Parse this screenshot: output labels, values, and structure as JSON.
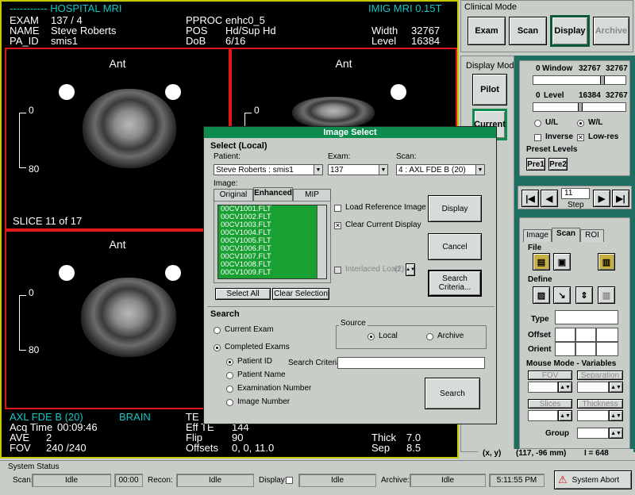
{
  "viewer": {
    "hospital": "----------- HOSPITAL MRI",
    "system": "IMIG MRI 0.15T",
    "exam_label": "EXAM",
    "exam_value": "137  / 4",
    "name_label": "NAME",
    "name_value": "Steve Roberts",
    "paid_label": "PA_ID",
    "paid_value": "smis1",
    "pproc_label": "PPROC",
    "pproc_value": "enhc0_5",
    "pos_label": "POS",
    "pos_value": "Hd/Sup  Hd",
    "dob_label": "DoB",
    "dob_value": "6/16",
    "width_label": "Width",
    "width_value": "32767",
    "level_label": "Level",
    "level_value": "16384",
    "ant": "Ant",
    "ruler_top": "0",
    "ruler_bottom": "80",
    "slice": "SLICE 11 of 17",
    "series": "AXL FDE B (20)",
    "region": "BRAIN",
    "acq_label": "Acq Time",
    "acq_value": "00:09:46",
    "ave_label": "AVE",
    "ave_value": "2",
    "fov_label": "FOV",
    "fov_value": "240  /240",
    "te_label": "TE",
    "effte_label": "Eff TE",
    "effte_value": "144",
    "flip_label": "Flip",
    "flip_value": "90",
    "offsets_label": "Offsets",
    "offsets_value": "0, 0, 11.0",
    "thick_label": "Thick",
    "thick_value": "7.0",
    "sep_label": "Sep",
    "sep_value": "8.5"
  },
  "clinical": {
    "title": "Clinical Mode",
    "buttons": [
      "Exam",
      "Scan",
      "Display",
      "Archive"
    ],
    "display_mode_title": "Display Mode",
    "pilot": "Pilot",
    "current": "Current"
  },
  "window_level": {
    "window_min": "0",
    "window_label": "Window",
    "window_value": "32767",
    "window_max": "32767",
    "level_min": "0",
    "level_label": "Level",
    "level_value": "16384",
    "level_max": "32767",
    "ul": "U/L",
    "wl": "W/L",
    "inverse": "Inverse",
    "lowres": "Low-res",
    "preset_title": "Preset Levels",
    "pre1": "Pre1",
    "pre2": "Pre2"
  },
  "stepper": {
    "value": "11",
    "step": "Step"
  },
  "tabs_panel": {
    "tabs": [
      "Image",
      "Scan",
      "ROI"
    ],
    "file": "File",
    "define": "Define",
    "type": "Type",
    "offset": "Offset",
    "orient": "Orient",
    "mouse_mode": "Mouse Mode - Variables",
    "fov": "FOV",
    "separation": "Separation",
    "slices": "Slices",
    "thickness": "Thickness",
    "group": "Group"
  },
  "coords": {
    "xy": "(x, y)",
    "xy_value": "(117, -96 mm)",
    "i": "I =  648"
  },
  "dialog": {
    "title": "Image Select",
    "select_local": "Select (Local)",
    "patient_label": "Patient:",
    "patient_value": "Steve Roberts : smis1",
    "exam_label": "Exam:",
    "exam_value": "137",
    "scan_label": "Scan:",
    "scan_value": "4 : AXL FDE B (20)",
    "image_label": "Image:",
    "image_tabs": [
      "Original",
      "Enhanced",
      "MIP"
    ],
    "files": [
      "00CV1001.FLT",
      "00CV1002.FLT",
      "00CV1003.FLT",
      "00CV1004.FLT",
      "00CV1005.FLT",
      "00CV1006.FLT",
      "00CV1007.FLT",
      "00CV1008.FLT",
      "00CV1009.FLT"
    ],
    "load_reference": "Load Reference Image",
    "clear_current": "Clear Current Display",
    "interlaced": "Interlaced  Load",
    "interlaced_value": "(2)",
    "display_btn": "Display",
    "cancel_btn": "Cancel",
    "search_criteria_btn": "Search Criteria...",
    "select_all": "Select All",
    "clear_selection": "Clear Selection",
    "search_title": "Search",
    "current_exam": "Current Exam",
    "completed_exams": "Completed Exams",
    "source_title": "Source",
    "local": "Local",
    "archive": "Archive",
    "patient_id": "Patient ID",
    "patient_name": "Patient Name",
    "exam_number": "Examination Number",
    "image_number": "Image Number",
    "search_criteria_label": "Search Criteria:",
    "search_btn": "Search"
  },
  "status": {
    "title": "System Status",
    "scan_label": "Scan:",
    "scan_value": "Idle",
    "scan_time": "00:00",
    "recon_label": "Recon:",
    "recon_value": "Idle",
    "display_label": "Display:",
    "display_value": "Idle",
    "archive_label": "Archive:",
    "archive_value": "Idle",
    "clock": "5:11:55 PM",
    "abort": "System Abort"
  }
}
